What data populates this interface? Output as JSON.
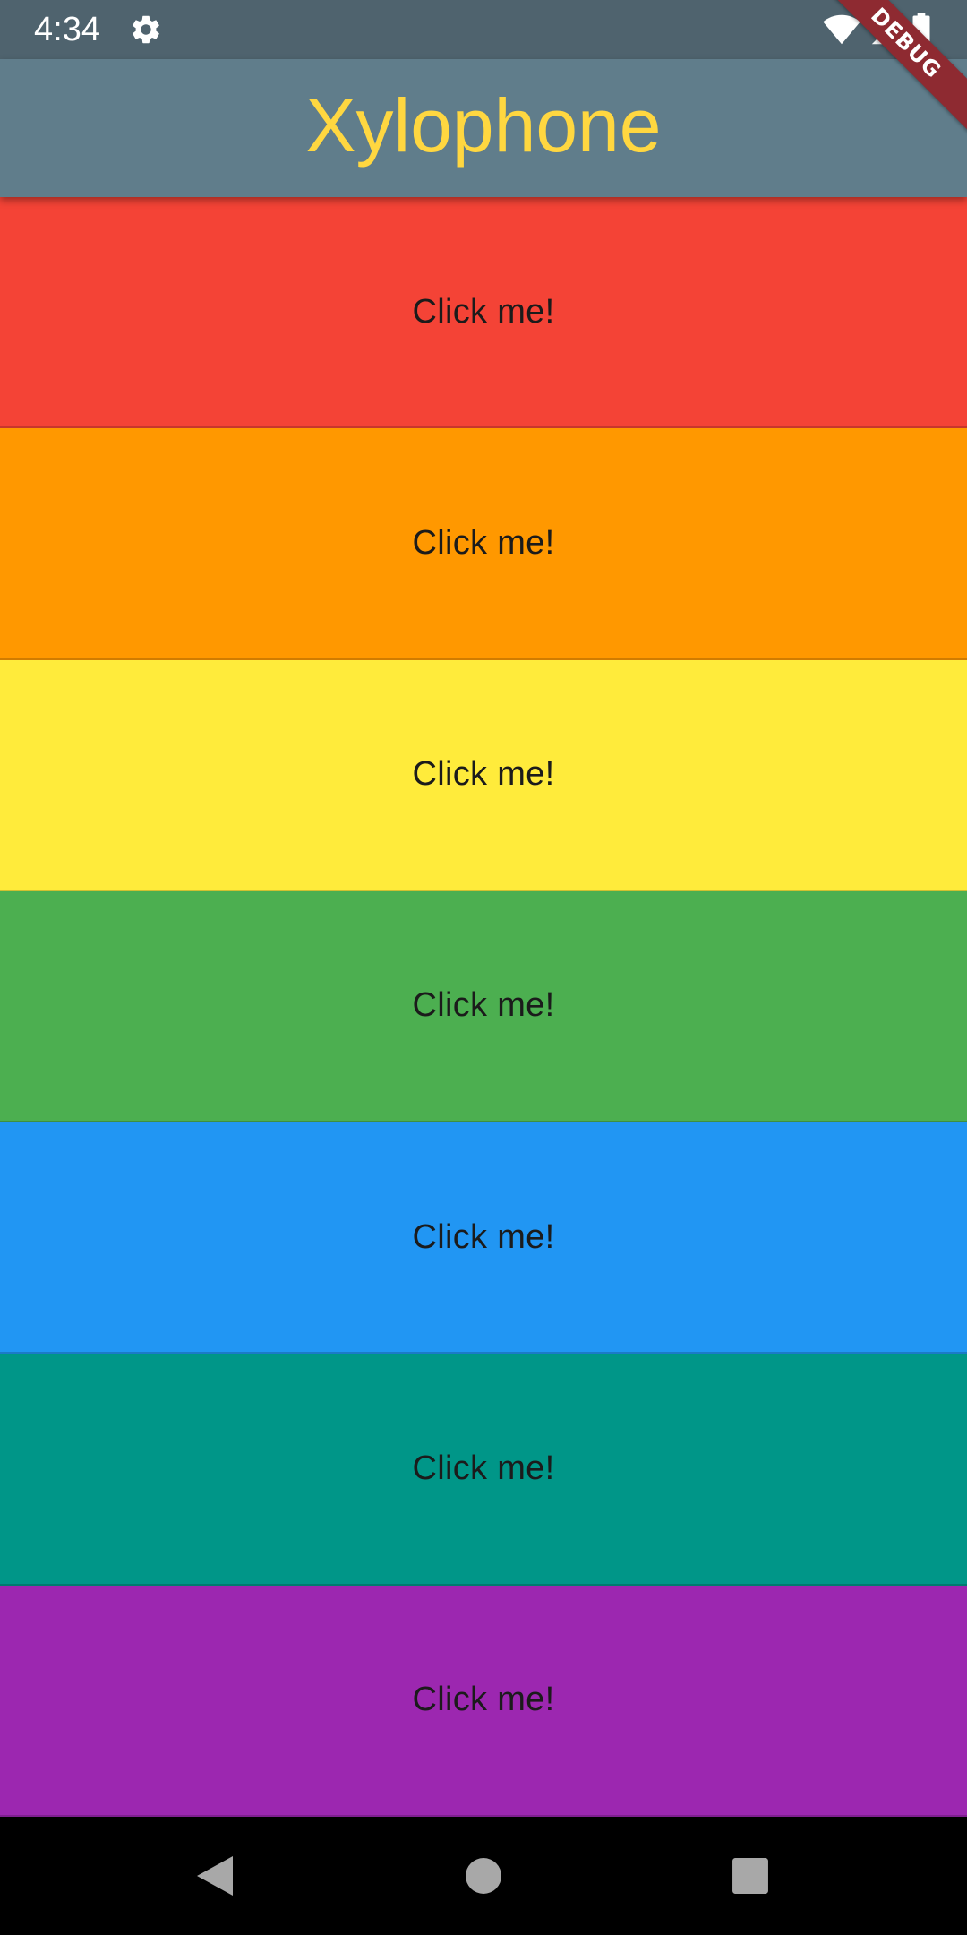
{
  "status_bar": {
    "time": "4:34",
    "icons": [
      "gear-icon",
      "wifi-icon",
      "cell-signal-icon",
      "battery-icon"
    ],
    "background": "#4f636e"
  },
  "app_bar": {
    "title": "Xylophone",
    "background": "#607d8b",
    "title_color": "#ffd740"
  },
  "debug_banner": {
    "label": "DEBUG",
    "color": "#8e2a31"
  },
  "keys": [
    {
      "label": "Click me!",
      "color": "#f44336"
    },
    {
      "label": "Click me!",
      "color": "#ff9800"
    },
    {
      "label": "Click me!",
      "color": "#ffeb3b"
    },
    {
      "label": "Click me!",
      "color": "#4caf50"
    },
    {
      "label": "Click me!",
      "color": "#2196f3"
    },
    {
      "label": "Click me!",
      "color": "#009688"
    },
    {
      "label": "Click me!",
      "color": "#9c27b0"
    }
  ],
  "nav_bar": {
    "icons": [
      "back-triangle-icon",
      "home-circle-icon",
      "recents-square-icon"
    ]
  }
}
